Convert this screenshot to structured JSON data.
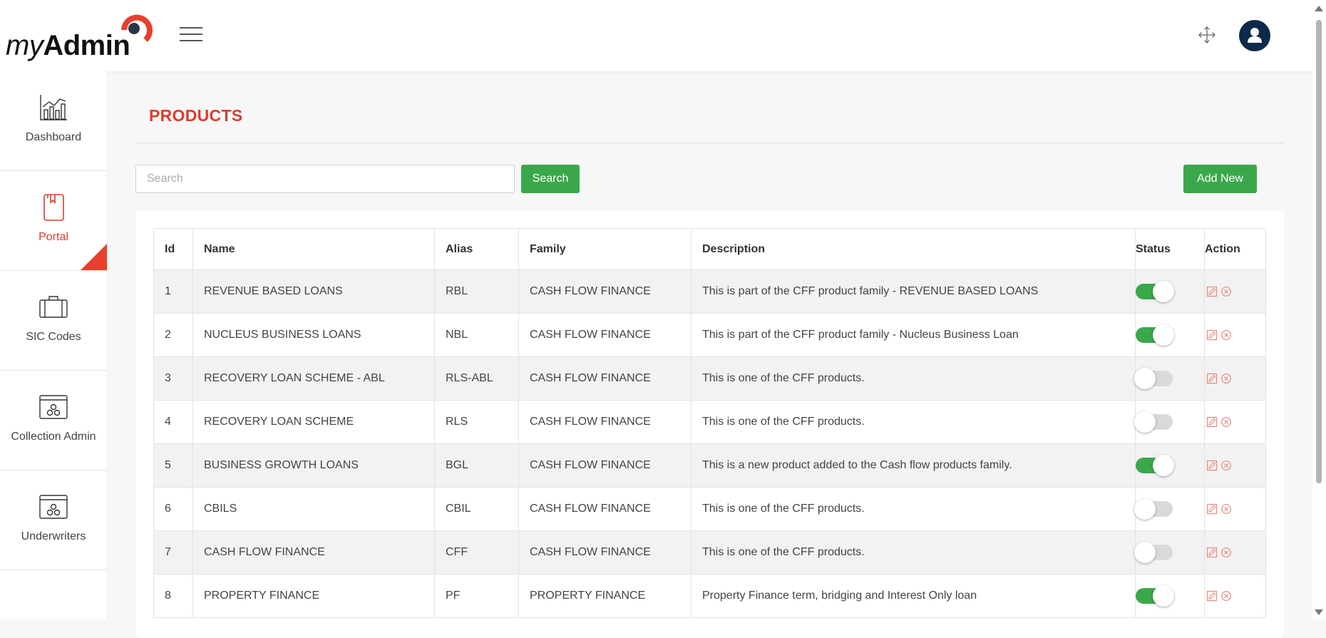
{
  "brand": {
    "logo_italic": "my",
    "logo_bold": "Admin",
    "accent_color": "#e8402c",
    "primary_color": "#3aa84a"
  },
  "header": {
    "menu_icon": "hamburger-icon",
    "fullscreen_icon": "expand-icon",
    "user_icon": "user-avatar-icon"
  },
  "sidebar": {
    "items": [
      {
        "label": "Dashboard",
        "icon": "chart-icon",
        "active": false
      },
      {
        "label": "Portal",
        "icon": "book-icon",
        "active": true
      },
      {
        "label": "SIC Codes",
        "icon": "briefcase-icon",
        "active": false
      },
      {
        "label": "Collection Admin",
        "icon": "settings-window-icon",
        "active": false
      },
      {
        "label": "Underwriters",
        "icon": "settings-window-icon",
        "active": false
      }
    ]
  },
  "page": {
    "title": "PRODUCTS"
  },
  "search": {
    "placeholder": "Search",
    "button_label": "Search"
  },
  "actions": {
    "add_new_label": "Add New"
  },
  "table": {
    "headers": {
      "id": "Id",
      "name": "Name",
      "alias": "Alias",
      "family": "Family",
      "description": "Description",
      "status": "Status",
      "action": "Action"
    },
    "rows": [
      {
        "id": "1",
        "name": "REVENUE BASED LOANS",
        "alias": "RBL",
        "family": "CASH FLOW FINANCE",
        "description": "This is part of the CFF product family - REVENUE BASED LOANS",
        "status": true
      },
      {
        "id": "2",
        "name": "NUCLEUS BUSINESS LOANS",
        "alias": "NBL",
        "family": "CASH FLOW FINANCE",
        "description": "This is part of the CFF product family - Nucleus Business Loan",
        "status": true
      },
      {
        "id": "3",
        "name": "RECOVERY LOAN SCHEME - ABL",
        "alias": "RLS-ABL",
        "family": "CASH FLOW FINANCE",
        "description": "This is one of the CFF products.",
        "status": false
      },
      {
        "id": "4",
        "name": "RECOVERY LOAN SCHEME",
        "alias": "RLS",
        "family": "CASH FLOW FINANCE",
        "description": "This is one of the CFF products.",
        "status": false
      },
      {
        "id": "5",
        "name": "BUSINESS GROWTH LOANS",
        "alias": "BGL",
        "family": "CASH FLOW FINANCE",
        "description": "This is a new product added to the Cash flow products family.",
        "status": true
      },
      {
        "id": "6",
        "name": "CBILS",
        "alias": "CBIL",
        "family": "CASH FLOW FINANCE",
        "description": "This is one of the CFF products.",
        "status": false
      },
      {
        "id": "7",
        "name": "CASH FLOW FINANCE",
        "alias": "CFF",
        "family": "CASH FLOW FINANCE",
        "description": "This is one of the CFF products.",
        "status": false
      },
      {
        "id": "8",
        "name": "PROPERTY FINANCE",
        "alias": "PF",
        "family": "PROPERTY FINANCE",
        "description": "Property Finance term, bridging and Interest Only loan",
        "status": true
      }
    ]
  }
}
